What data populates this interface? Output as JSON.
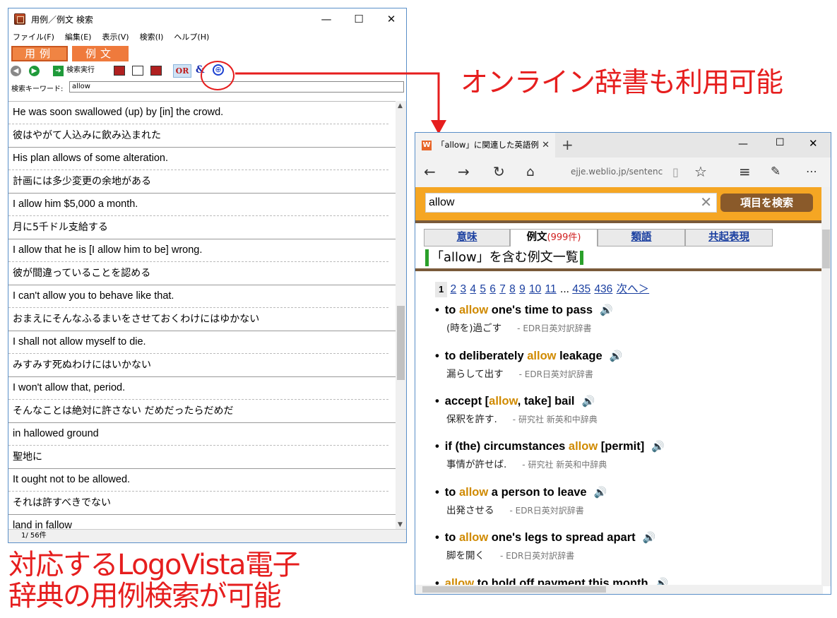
{
  "left_window": {
    "title": "用例／例文 検索",
    "controls": {
      "minimize": "—",
      "maximize": "☐",
      "close": "✕"
    },
    "menu": [
      "ファイル(F)",
      "編集(E)",
      "表示(V)",
      "検索(I)",
      "ヘルプ(H)"
    ],
    "modes": [
      "用例",
      "例文"
    ],
    "toolbar": {
      "search_button": "検索実行",
      "or_label": "OR",
      "and_label": "&"
    },
    "keyword_label": "検索キーワード:",
    "keyword_value": "allow",
    "results": [
      {
        "en": "He was soon swallowed (up) by [in] the crowd.",
        "ja": "彼はやがて人込みに飲み込まれた"
      },
      {
        "en": "His plan allows of some alteration.",
        "ja": "計画には多少変更の余地がある"
      },
      {
        "en": "I allow him $5,000 a month.",
        "ja": "月に5千ドル支給する"
      },
      {
        "en": "I allow that he is [I allow him to be] wrong.",
        "ja": "彼が間違っていることを認める"
      },
      {
        "en": "I can't allow you to behave like that.",
        "ja": "おまえにそんなふるまいをさせておくわけにはゆかない"
      },
      {
        "en": "I shall not allow myself to die.",
        "ja": "みすみす死ぬわけにはいかない"
      },
      {
        "en": "I won't allow that, period.",
        "ja": "そんなことは絶対に許さない だめだったらだめだ"
      },
      {
        "en": "in hallowed ground",
        "ja": "聖地に"
      },
      {
        "en": "It ought not to be allowed.",
        "ja": "それは許すべきでない"
      },
      {
        "en": "land in fallow",
        "ja": ""
      }
    ],
    "status": "1/  56件"
  },
  "browser": {
    "tab_title": "「allow」に関連した英語例",
    "favicon": "W",
    "new_tab": "+",
    "url": "ejje.weblio.jp/sentenc",
    "search_value": "allow",
    "search_button": "項目を検索",
    "tabs": [
      {
        "label": "意味",
        "count": ""
      },
      {
        "label": "例文",
        "count": "(999件)"
      },
      {
        "label": "類語",
        "count": ""
      },
      {
        "label": "共起表現",
        "count": ""
      }
    ],
    "heading": "「allow」を含む例文一覧",
    "pager": {
      "current": "1",
      "pages": [
        "2",
        "3",
        "4",
        "5",
        "6",
        "7",
        "8",
        "9",
        "10",
        "11"
      ],
      "ellipsis": "...",
      "last_pages": [
        "435",
        "436"
      ],
      "next": "次へ＞"
    },
    "entries": [
      {
        "pre": "to ",
        "hl": "allow",
        "post": " one's time to pass",
        "jp": "(時を)過ごす",
        "src": "- EDR日英対訳辞書"
      },
      {
        "pre": "to deliberately ",
        "hl": "allow",
        "post": " leakage",
        "jp": "漏らして出す",
        "src": "- EDR日英対訳辞書"
      },
      {
        "pre": "accept [",
        "hl": "allow",
        "post": ", take] bail",
        "jp": "保釈を許す.",
        "src": "- 研究社 新英和中辞典"
      },
      {
        "pre": "if (the) circumstances ",
        "hl": "allow",
        "post": " [permit]",
        "jp": "事情が許せば.",
        "src": "- 研究社 新英和中辞典"
      },
      {
        "pre": "to ",
        "hl": "allow",
        "post": " a person to leave",
        "jp": "出発させる",
        "src": "- EDR日英対訳辞書"
      },
      {
        "pre": "to ",
        "hl": "allow",
        "post": " one's legs to spread apart",
        "jp": "脚を開く",
        "src": "- EDR日英対訳辞書"
      },
      {
        "pre": "",
        "hl": "allow",
        "post": " to hold off payment this month",
        "jp": "",
        "src": ""
      }
    ]
  },
  "captions": {
    "online": "オンライン辞書も利用可能",
    "left_line1": "対応するLogoVista電子",
    "left_line2": "辞典の用例検索が可能"
  },
  "colors": {
    "caption_red": "#e61e1e",
    "mode_orange": "#ef7a3c",
    "highlight": "#d08a00",
    "search_band": "#f5a623"
  }
}
